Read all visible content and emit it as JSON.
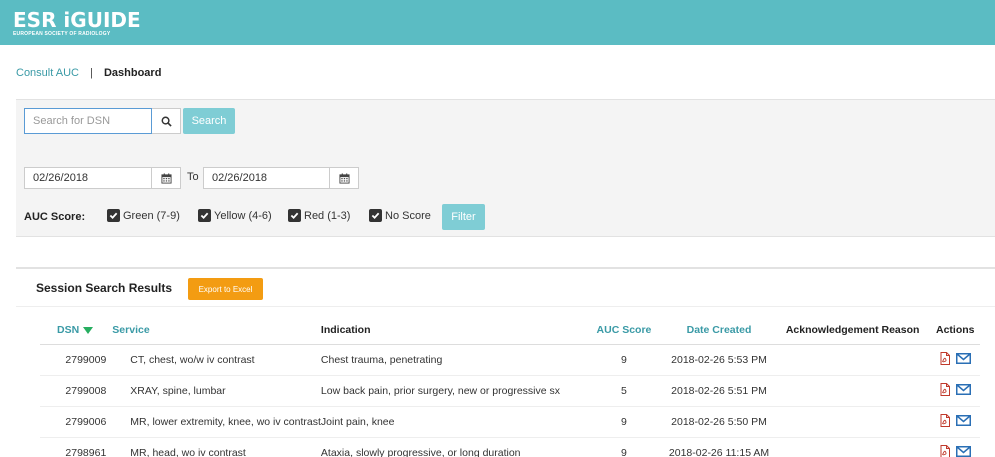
{
  "header": {
    "logo_main": "ESR iGUIDE",
    "logo_sub": "EUROPEAN SOCIETY OF RADIOLOGY",
    "bg_color": "#5bbcc3"
  },
  "breadcrumb": {
    "link": "Consult AUC",
    "separator": "|",
    "current": "Dashboard"
  },
  "search": {
    "placeholder": "Search for DSN",
    "value": "",
    "button_label": "Search",
    "icon": "search-icon"
  },
  "dates": {
    "from": "02/26/2018",
    "to_label": "To",
    "to": "02/26/2018",
    "icon": "calendar-icon"
  },
  "auc_filter": {
    "label": "AUC Score:",
    "options": [
      {
        "label": "Green (7-9)",
        "checked": true
      },
      {
        "label": "Yellow (4-6)",
        "checked": true
      },
      {
        "label": "Red (1-3)",
        "checked": true
      },
      {
        "label": "No Score",
        "checked": true
      }
    ],
    "button_label": "Filter"
  },
  "results": {
    "title": "Session Search Results",
    "export_label": "Export to Excel",
    "export_color": "#f39c12",
    "columns": [
      "DSN",
      "Service",
      "Indication",
      "AUC Score",
      "Date Created",
      "Acknowledgement Reason",
      "Actions"
    ],
    "rows": [
      {
        "dsn": "2799009",
        "service": "CT, chest, wo/w iv contrast",
        "indication": "Chest trauma, penetrating",
        "auc": "9",
        "date": "2018-02-26 5:53 PM",
        "ack": ""
      },
      {
        "dsn": "2799008",
        "service": "XRAY, spine, lumbar",
        "indication": "Low back pain, prior surgery, new or progressive sx",
        "auc": "5",
        "date": "2018-02-26 5:51 PM",
        "ack": ""
      },
      {
        "dsn": "2799006",
        "service": "MR, lower extremity, knee, wo iv contrast",
        "indication": "Joint pain, knee",
        "auc": "9",
        "date": "2018-02-26 5:50 PM",
        "ack": ""
      },
      {
        "dsn": "2798961",
        "service": "MR, head, wo iv contrast",
        "indication": "Ataxia, slowly progressive, or long duration",
        "auc": "9",
        "date": "2018-02-26 11:15 AM",
        "ack": ""
      }
    ],
    "action_icons": [
      "pdf-icon",
      "email-icon"
    ]
  }
}
